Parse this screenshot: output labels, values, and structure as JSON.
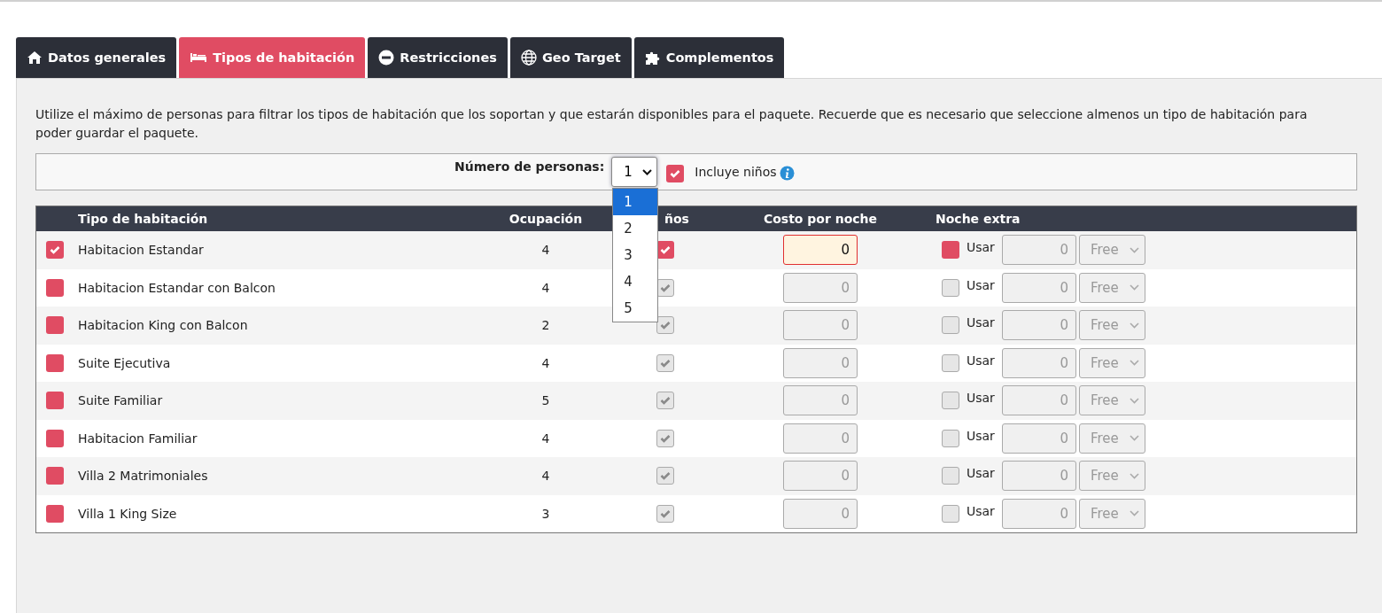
{
  "tabs": [
    {
      "label": "Datos generales",
      "selected": false
    },
    {
      "label": "Tipos de habitación",
      "selected": true
    },
    {
      "label": "Restricciones",
      "selected": false
    },
    {
      "label": "Geo Target",
      "selected": false
    },
    {
      "label": "Complementos",
      "selected": false
    }
  ],
  "intro": "Utilize el máximo de personas para filtrar los tipos de habitación que los soportan y que estarán disponibles para el paquete. Recuerde que es necesario que seleccione almenos un tipo de habitación para poder guardar el paquete.",
  "filter": {
    "label": "Número de personas:",
    "value": "1",
    "options": [
      {
        "label": "1",
        "selected": true
      },
      {
        "label": "2",
        "selected": false
      },
      {
        "label": "3",
        "selected": false
      },
      {
        "label": "4",
        "selected": false
      },
      {
        "label": "5",
        "selected": false
      }
    ],
    "kids_label": "Incluye niños",
    "kids_checked": true
  },
  "table": {
    "columns": [
      "Tipo de habitación",
      "Ocupación",
      "ños",
      "Costo por noche",
      "Noche extra"
    ],
    "rows": [
      {
        "checked": true,
        "name": "Habitacion Estandar",
        "occupancy": "4",
        "kids": true,
        "cost": "0",
        "extra_use": false,
        "extra_label": "Usar",
        "extra_value": "0",
        "extra_option": "Free"
      },
      {
        "checked": false,
        "name": "Habitacion Estandar con Balcon",
        "occupancy": "4",
        "kids": true,
        "cost": "0",
        "extra_use": false,
        "extra_label": "Usar",
        "extra_value": "0",
        "extra_option": "Free"
      },
      {
        "checked": false,
        "name": "Habitacion King con Balcon",
        "occupancy": "2",
        "kids": true,
        "cost": "0",
        "extra_use": false,
        "extra_label": "Usar",
        "extra_value": "0",
        "extra_option": "Free"
      },
      {
        "checked": false,
        "name": "Suite Ejecutiva",
        "occupancy": "4",
        "kids": true,
        "cost": "0",
        "extra_use": false,
        "extra_label": "Usar",
        "extra_value": "0",
        "extra_option": "Free"
      },
      {
        "checked": false,
        "name": "Suite Familiar",
        "occupancy": "5",
        "kids": true,
        "cost": "0",
        "extra_use": false,
        "extra_label": "Usar",
        "extra_value": "0",
        "extra_option": "Free"
      },
      {
        "checked": false,
        "name": "Habitacion Familiar",
        "occupancy": "4",
        "kids": true,
        "cost": "0",
        "extra_use": false,
        "extra_label": "Usar",
        "extra_value": "0",
        "extra_option": "Free"
      },
      {
        "checked": false,
        "name": "Villa 2 Matrimoniales",
        "occupancy": "4",
        "kids": true,
        "cost": "0",
        "extra_use": false,
        "extra_label": "Usar",
        "extra_value": "0",
        "extra_option": "Free"
      },
      {
        "checked": false,
        "name": "Villa 1 King Size",
        "occupancy": "3",
        "kids": true,
        "cost": "0",
        "extra_use": false,
        "extra_label": "Usar",
        "extra_value": "0",
        "extra_option": "Free"
      }
    ]
  }
}
